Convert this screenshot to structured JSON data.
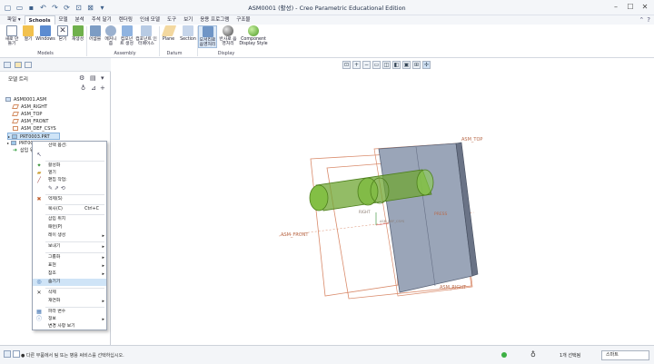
{
  "window": {
    "title": "ASM0001 (활성) - Creo Parametric Educational Edition",
    "controls": [
      "minimize",
      "maximize",
      "close"
    ]
  },
  "quick_access": [
    "new-icon",
    "open-icon",
    "save-icon",
    "undo-icon",
    "redo-icon",
    "regenerate-icon",
    "windows-icon",
    "close-window-icon",
    "customize-icon"
  ],
  "tabs": [
    {
      "label": "파일 ▾"
    },
    {
      "label": "Schools"
    },
    {
      "label": "모델"
    },
    {
      "label": "분석"
    },
    {
      "label": "주석 달기"
    },
    {
      "label": "렌더링"
    },
    {
      "label": "인쇄 모델"
    },
    {
      "label": "도구"
    },
    {
      "label": "보기"
    },
    {
      "label": "응용 프로그램"
    },
    {
      "label": "구조물"
    }
  ],
  "ribbon": {
    "buttons": [
      {
        "label": "새로 만들기",
        "icon": "new-doc-icon"
      },
      {
        "label": "열기",
        "icon": "folder-open-icon"
      },
      {
        "label": "Windows",
        "icon": "windows-icon"
      },
      {
        "label": "닫기",
        "icon": "close-icon"
      },
      {
        "label": "재생성",
        "icon": "regenerate-icon"
      },
      {
        "label": "어셈블",
        "icon": "assemble-icon"
      },
      {
        "label": "메커니즘",
        "icon": "mechanism-icon"
      },
      {
        "label": "컴포넌트 생성",
        "icon": "create-component-icon"
      },
      {
        "label": "컴포넌트 인터페이스",
        "icon": "component-interface-icon"
      },
      {
        "label": "Plane",
        "icon": "plane-icon"
      },
      {
        "label": "Section",
        "icon": "section-icon"
      },
      {
        "label": "모서리로 음영처리",
        "icon": "shading-edges-icon"
      },
      {
        "label": "반사로 음영처리",
        "icon": "shading-reflections-icon"
      },
      {
        "label": "Component Display Style",
        "icon": "component-display-style-icon"
      }
    ],
    "groups": [
      "Models",
      "Assembly",
      "Datum",
      "Display"
    ]
  },
  "model_tree": {
    "title": "모델 트리",
    "items": [
      {
        "label": "ASM0001.ASM",
        "type": "assembly"
      },
      {
        "label": "ASM_RIGHT",
        "type": "datum-plane"
      },
      {
        "label": "ASM_TOP",
        "type": "datum-plane"
      },
      {
        "label": "ASM_FRONT",
        "type": "datum-plane"
      },
      {
        "label": "ASM_DEF_CSYS",
        "type": "csys"
      },
      {
        "label": "PRT0003.PRT",
        "type": "part",
        "selected": true
      },
      {
        "label": "PRT000",
        "type": "part"
      },
      {
        "label": "삽입 위",
        "type": "insert"
      }
    ]
  },
  "context_menu": {
    "items": [
      {
        "label": "선택 옵션:",
        "icon": ""
      },
      {
        "label": "",
        "icon": "select-icon"
      },
      {
        "label": "활성화",
        "icon": "activate-icon"
      },
      {
        "label": "열기",
        "icon": "open-icon"
      },
      {
        "label": "편집 작업:",
        "icon": "edit-icon"
      },
      {
        "label": "",
        "icon": "edit-tools-icon"
      },
      {
        "label": "억제(S)",
        "icon": "suppress-icon"
      },
      {
        "label": "복사(C)",
        "icon": "",
        "shortcut": "Ctrl+C"
      },
      {
        "label": "삽입 위치",
        "icon": ""
      },
      {
        "label": "패턴(P)",
        "icon": ""
      },
      {
        "label": "레이 생성",
        "icon": "",
        "submenu": true
      },
      {
        "label": "보내기",
        "icon": "",
        "submenu": true
      },
      {
        "label": "그룹화",
        "icon": "",
        "submenu": true
      },
      {
        "label": "표현",
        "icon": "",
        "submenu": true
      },
      {
        "label": "참조",
        "icon": "",
        "submenu": true
      },
      {
        "label": "숨기기",
        "icon": "hide-icon",
        "highlighted": true
      },
      {
        "label": "삭제",
        "icon": "delete-icon"
      },
      {
        "label": "재연화",
        "icon": "",
        "submenu": true
      },
      {
        "label": "파라 변수",
        "icon": "parameters-icon"
      },
      {
        "label": "정보",
        "icon": "info-icon",
        "submenu": true
      },
      {
        "label": "변경 사항 보기",
        "icon": ""
      }
    ]
  },
  "viewport": {
    "labels": {
      "asm_top": "ASM_TOP",
      "asm_front": "ASM_FRONT",
      "asm_right": "ASM_RIGHT",
      "right_plane_label": "RIGHT",
      "partial_label": "PRESS",
      "csys_label": "ASM_DEF_CSYS"
    },
    "toolbar": [
      "refit-icon",
      "zoom-in-icon",
      "zoom-out-icon",
      "repaint-icon",
      "saved-orientations-icon",
      "display-style-icon",
      "view-manager-icon",
      "datum-display-icon",
      "spin-center-icon"
    ]
  },
  "statusbar": {
    "message": "● 다른 부품에서 팀 또는 병용 써비스를 선택하십시오.",
    "selected": "1개 선택됨",
    "filter": "스마트"
  },
  "colors": {
    "accent": "#2b579a",
    "part_green": "#7ac943",
    "plane_orange": "#d98a6a",
    "block_gray": "#98a3b4"
  }
}
